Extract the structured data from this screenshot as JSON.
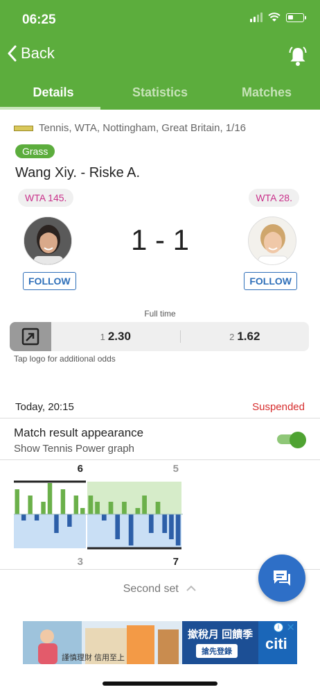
{
  "status_bar": {
    "time": "06:25"
  },
  "header": {
    "back_label": "Back",
    "tabs": [
      {
        "label": "Details",
        "active": true
      },
      {
        "label": "Statistics",
        "active": false
      },
      {
        "label": "Matches",
        "active": false
      }
    ]
  },
  "match": {
    "league": "Tennis, WTA, Nottingham, Great Britain, 1/16",
    "surface": "Grass",
    "title": "Wang Xiy. - Riske A.",
    "home": {
      "rank": "WTA 145.",
      "follow_label": "FOLLOW"
    },
    "away": {
      "rank": "WTA 28.",
      "follow_label": "FOLLOW"
    },
    "score": "1 - 1",
    "state": "Full time"
  },
  "odds": {
    "home_index": "1",
    "home_value": "2.30",
    "away_index": "2",
    "away_value": "1.62",
    "hint": "Tap logo for additional odds"
  },
  "info": {
    "datetime": "Today, 20:15",
    "status": "Suspended"
  },
  "toggle": {
    "title": "Match result appearance",
    "subtitle": "Show Tennis Power graph",
    "on": true
  },
  "power_graph": {
    "sets": [
      {
        "home_games": "6",
        "away_games": "3",
        "bars": [
          4,
          -1,
          3,
          -1,
          2,
          5,
          -3,
          4,
          -2,
          3,
          1
        ]
      },
      {
        "home_games": "5",
        "away_games": "7",
        "bars": [
          3,
          2,
          -1,
          2,
          -4,
          2,
          -5,
          1,
          3,
          -3,
          2,
          -3,
          -4,
          -5
        ]
      }
    ]
  },
  "set_label": "Second set",
  "ad": {
    "headline": "撳稅月 回饋季",
    "cta": "搶先登錄",
    "brand": "citi",
    "disclaimer": "謹慎理財 信用至上"
  },
  "colors": {
    "brand_green": "#5cad3d",
    "accent_blue": "#2e6fc7",
    "rank_pink": "#c9308a",
    "status_red": "#d62d2d"
  }
}
